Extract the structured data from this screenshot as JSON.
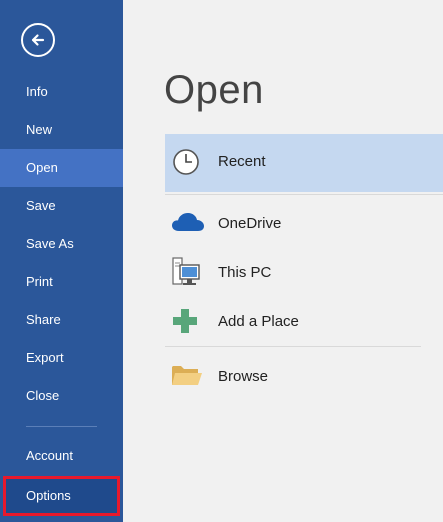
{
  "sidebar": {
    "back_icon": "back-arrow-icon",
    "items": [
      {
        "label": "Info"
      },
      {
        "label": "New"
      },
      {
        "label": "Open"
      },
      {
        "label": "Save"
      },
      {
        "label": "Save As"
      },
      {
        "label": "Print"
      },
      {
        "label": "Share"
      },
      {
        "label": "Export"
      },
      {
        "label": "Close"
      },
      {
        "label": "Account"
      },
      {
        "label": "Options"
      }
    ],
    "active_item": "Open",
    "highlighted_item": "Options"
  },
  "main": {
    "title": "Open",
    "places": [
      {
        "label": "Recent",
        "icon": "clock-icon",
        "selected": true
      },
      {
        "label": "OneDrive",
        "icon": "cloud-icon"
      },
      {
        "label": "This PC",
        "icon": "computer-icon"
      },
      {
        "label": "Add a Place",
        "icon": "plus-icon"
      },
      {
        "label": "Browse",
        "icon": "folder-icon"
      }
    ]
  },
  "colors": {
    "sidebar_bg": "#2b579a",
    "sidebar_active": "#4472c4",
    "highlight_border": "#e8192c",
    "selected_place_bg": "#c5d8f0",
    "page_bg": "#f1f1f1"
  }
}
